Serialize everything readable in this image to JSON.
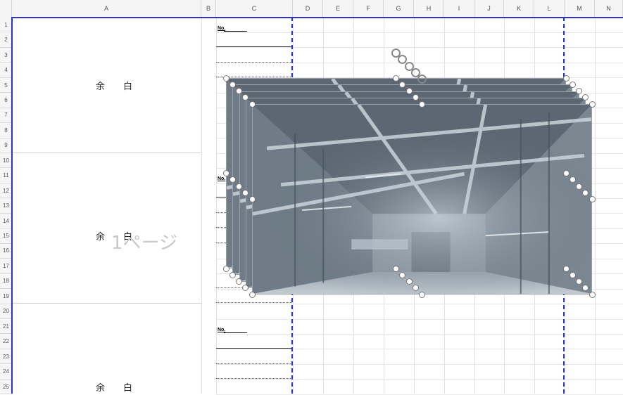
{
  "columns": [
    "A",
    "B",
    "C",
    "D",
    "E",
    "F",
    "G",
    "H",
    "I",
    "J",
    "K",
    "L",
    "M",
    "N"
  ],
  "rows": [
    "1",
    "2",
    "3",
    "4",
    "5",
    "6",
    "7",
    "8",
    "9",
    "10",
    "11",
    "12",
    "13",
    "14",
    "15",
    "16",
    "17",
    "18",
    "19",
    "20",
    "21",
    "22",
    "23",
    "24",
    "25"
  ],
  "margin_text": "余白",
  "no_label": "No.",
  "page_watermark": "1ページ",
  "image": {
    "name": "tunnel-ducts-photo",
    "count": 5
  },
  "colors": {
    "page_break": "#2a35c8",
    "grid": "#e2e2e2",
    "header_bg": "#f5f5f5"
  }
}
